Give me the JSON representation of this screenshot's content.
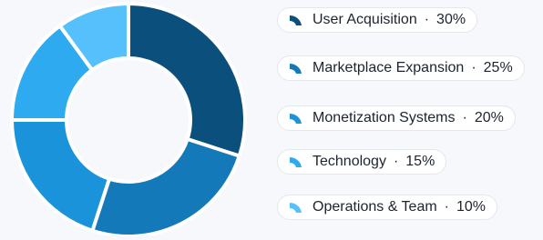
{
  "chart_data": {
    "type": "pie",
    "variant": "donut",
    "title": "",
    "legend_position": "right",
    "slices": [
      {
        "label": "User Acquisition",
        "value": 30,
        "display": "30%",
        "color": "#0b4f7c"
      },
      {
        "label": "Marketplace Expansion",
        "value": 25,
        "display": "25%",
        "color": "#1479b8"
      },
      {
        "label": "Monetization Systems",
        "value": 20,
        "display": "20%",
        "color": "#1a93da"
      },
      {
        "label": "Technology",
        "value": 15,
        "display": "15%",
        "color": "#2eaaf0"
      },
      {
        "label": "Operations & Team",
        "value": 10,
        "display": "10%",
        "color": "#55c0fb"
      }
    ]
  }
}
